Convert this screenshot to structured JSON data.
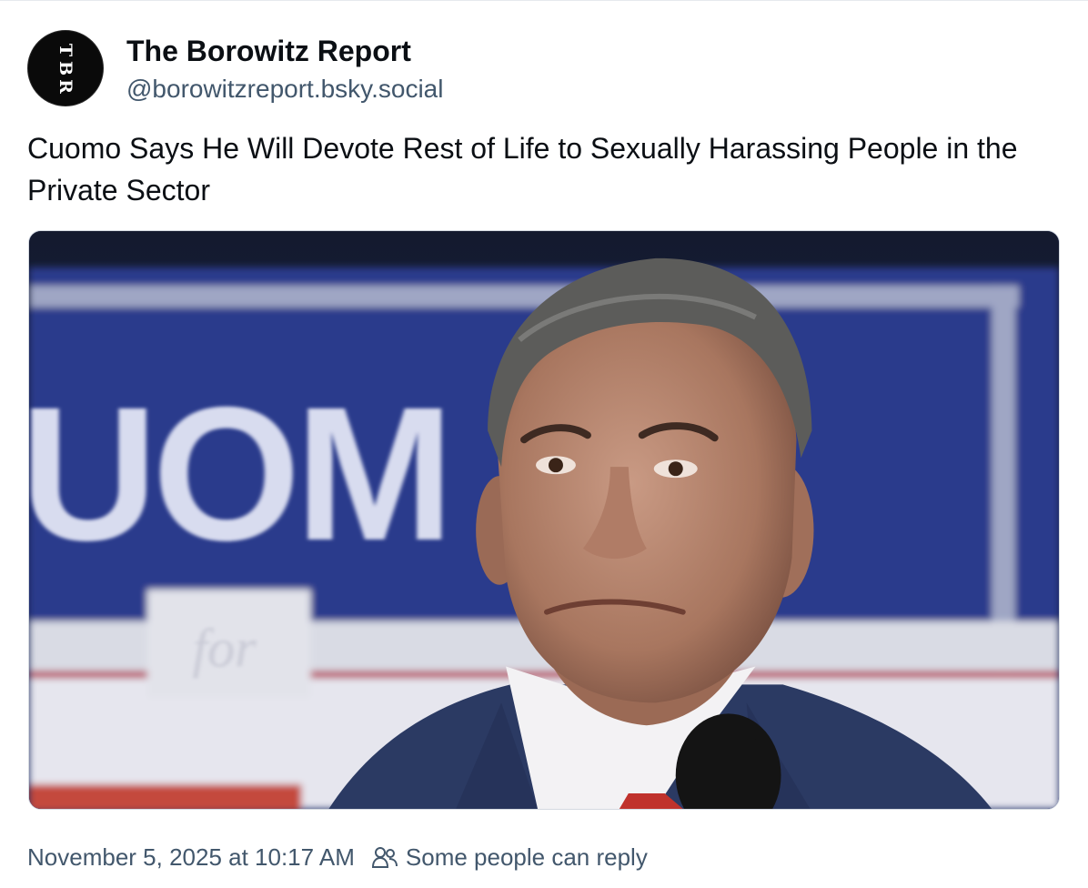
{
  "post": {
    "author": {
      "display_name": "The Borowitz Report",
      "handle": "@borowitzreport.bsky.social",
      "avatar_letters": [
        "T",
        "B",
        "R"
      ]
    },
    "text": "Cuomo Says He Will Devote Rest of Life to Sexually Harassing People in the Private Sector",
    "image": {
      "sign_text": "UOM",
      "sign_small_text": "for"
    },
    "timestamp": "November 5, 2025 at 10:17 AM",
    "reply_setting": "Some people can reply",
    "reply_icon": "people-icon"
  },
  "colors": {
    "text": "#0b0f14",
    "muted": "#42576c",
    "sign_blue": "#2a3a8c",
    "suit": "#2b3a63"
  }
}
